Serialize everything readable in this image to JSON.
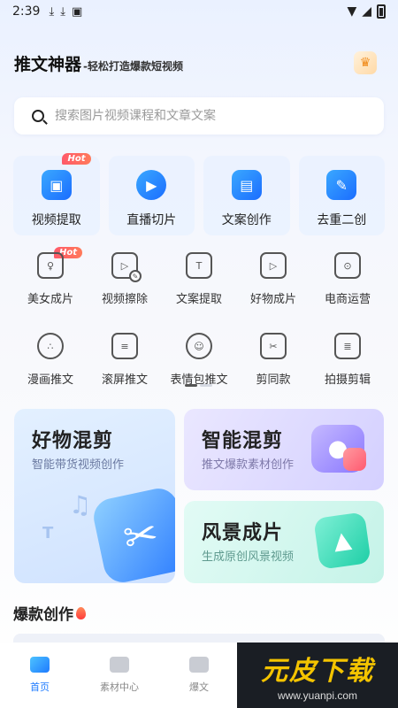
{
  "status_bar": {
    "time": "2:39"
  },
  "header": {
    "title": "推文神器",
    "subtitle": "-轻松打造爆款短视频"
  },
  "search": {
    "placeholder": "搜索图片视频课程和文章文案"
  },
  "big_tools": [
    {
      "label": "视频提取",
      "hot": true
    },
    {
      "label": "直播切片",
      "hot": false
    },
    {
      "label": "文案创作",
      "hot": false
    },
    {
      "label": "去重二创",
      "hot": false
    }
  ],
  "hot_label": "Hot",
  "grid_tools": [
    {
      "label": "美女成片"
    },
    {
      "label": "视频擦除"
    },
    {
      "label": "文案提取"
    },
    {
      "label": "好物成片"
    },
    {
      "label": "电商运营"
    },
    {
      "label": "漫画推文"
    },
    {
      "label": "滚屏推文"
    },
    {
      "label": "表情包推文"
    },
    {
      "label": "剪同款"
    },
    {
      "label": "拍摄剪辑"
    }
  ],
  "cards": [
    {
      "title": "好物混剪",
      "subtitle": "智能带货视频创作"
    },
    {
      "title": "智能混剪",
      "subtitle": "推文爆款素材创作"
    },
    {
      "title": "风景成片",
      "subtitle": "生成原创风景视频"
    }
  ],
  "section": {
    "title": "爆款创作"
  },
  "tabbar": [
    {
      "label": "首页",
      "active": true
    },
    {
      "label": "素材中心",
      "active": false
    },
    {
      "label": "爆文",
      "active": false
    }
  ],
  "watermark": {
    "main": "元皮下载",
    "url": "www.yuanpi.com"
  },
  "colors": {
    "accent": "#1e7bff",
    "hot": "#ff5a6a",
    "watermark_yellow": "#f4c400"
  }
}
